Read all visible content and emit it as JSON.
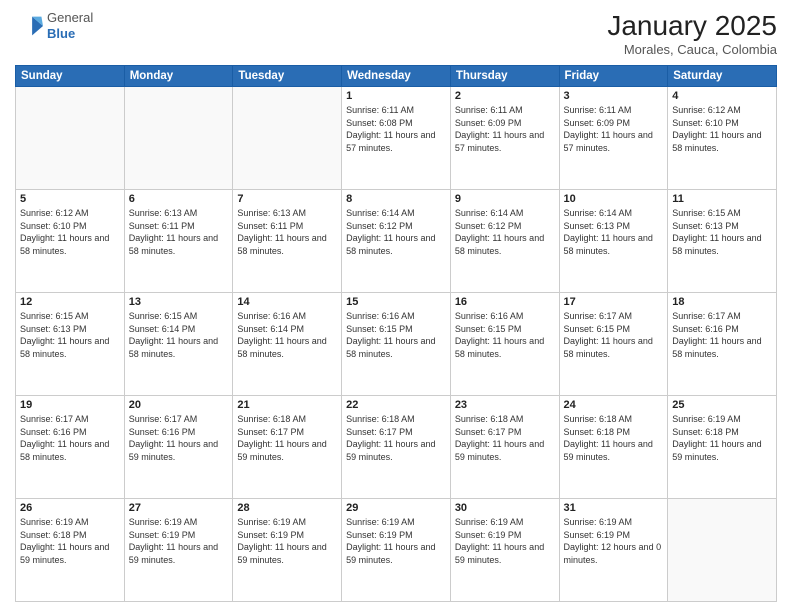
{
  "logo": {
    "general": "General",
    "blue": "Blue"
  },
  "header": {
    "title": "January 2025",
    "subtitle": "Morales, Cauca, Colombia"
  },
  "weekdays": [
    "Sunday",
    "Monday",
    "Tuesday",
    "Wednesday",
    "Thursday",
    "Friday",
    "Saturday"
  ],
  "weeks": [
    [
      {
        "day": "",
        "info": ""
      },
      {
        "day": "",
        "info": ""
      },
      {
        "day": "",
        "info": ""
      },
      {
        "day": "1",
        "info": "Sunrise: 6:11 AM\nSunset: 6:08 PM\nDaylight: 11 hours and 57 minutes."
      },
      {
        "day": "2",
        "info": "Sunrise: 6:11 AM\nSunset: 6:09 PM\nDaylight: 11 hours and 57 minutes."
      },
      {
        "day": "3",
        "info": "Sunrise: 6:11 AM\nSunset: 6:09 PM\nDaylight: 11 hours and 57 minutes."
      },
      {
        "day": "4",
        "info": "Sunrise: 6:12 AM\nSunset: 6:10 PM\nDaylight: 11 hours and 58 minutes."
      }
    ],
    [
      {
        "day": "5",
        "info": "Sunrise: 6:12 AM\nSunset: 6:10 PM\nDaylight: 11 hours and 58 minutes."
      },
      {
        "day": "6",
        "info": "Sunrise: 6:13 AM\nSunset: 6:11 PM\nDaylight: 11 hours and 58 minutes."
      },
      {
        "day": "7",
        "info": "Sunrise: 6:13 AM\nSunset: 6:11 PM\nDaylight: 11 hours and 58 minutes."
      },
      {
        "day": "8",
        "info": "Sunrise: 6:14 AM\nSunset: 6:12 PM\nDaylight: 11 hours and 58 minutes."
      },
      {
        "day": "9",
        "info": "Sunrise: 6:14 AM\nSunset: 6:12 PM\nDaylight: 11 hours and 58 minutes."
      },
      {
        "day": "10",
        "info": "Sunrise: 6:14 AM\nSunset: 6:13 PM\nDaylight: 11 hours and 58 minutes."
      },
      {
        "day": "11",
        "info": "Sunrise: 6:15 AM\nSunset: 6:13 PM\nDaylight: 11 hours and 58 minutes."
      }
    ],
    [
      {
        "day": "12",
        "info": "Sunrise: 6:15 AM\nSunset: 6:13 PM\nDaylight: 11 hours and 58 minutes."
      },
      {
        "day": "13",
        "info": "Sunrise: 6:15 AM\nSunset: 6:14 PM\nDaylight: 11 hours and 58 minutes."
      },
      {
        "day": "14",
        "info": "Sunrise: 6:16 AM\nSunset: 6:14 PM\nDaylight: 11 hours and 58 minutes."
      },
      {
        "day": "15",
        "info": "Sunrise: 6:16 AM\nSunset: 6:15 PM\nDaylight: 11 hours and 58 minutes."
      },
      {
        "day": "16",
        "info": "Sunrise: 6:16 AM\nSunset: 6:15 PM\nDaylight: 11 hours and 58 minutes."
      },
      {
        "day": "17",
        "info": "Sunrise: 6:17 AM\nSunset: 6:15 PM\nDaylight: 11 hours and 58 minutes."
      },
      {
        "day": "18",
        "info": "Sunrise: 6:17 AM\nSunset: 6:16 PM\nDaylight: 11 hours and 58 minutes."
      }
    ],
    [
      {
        "day": "19",
        "info": "Sunrise: 6:17 AM\nSunset: 6:16 PM\nDaylight: 11 hours and 58 minutes."
      },
      {
        "day": "20",
        "info": "Sunrise: 6:17 AM\nSunset: 6:16 PM\nDaylight: 11 hours and 59 minutes."
      },
      {
        "day": "21",
        "info": "Sunrise: 6:18 AM\nSunset: 6:17 PM\nDaylight: 11 hours and 59 minutes."
      },
      {
        "day": "22",
        "info": "Sunrise: 6:18 AM\nSunset: 6:17 PM\nDaylight: 11 hours and 59 minutes."
      },
      {
        "day": "23",
        "info": "Sunrise: 6:18 AM\nSunset: 6:17 PM\nDaylight: 11 hours and 59 minutes."
      },
      {
        "day": "24",
        "info": "Sunrise: 6:18 AM\nSunset: 6:18 PM\nDaylight: 11 hours and 59 minutes."
      },
      {
        "day": "25",
        "info": "Sunrise: 6:19 AM\nSunset: 6:18 PM\nDaylight: 11 hours and 59 minutes."
      }
    ],
    [
      {
        "day": "26",
        "info": "Sunrise: 6:19 AM\nSunset: 6:18 PM\nDaylight: 11 hours and 59 minutes."
      },
      {
        "day": "27",
        "info": "Sunrise: 6:19 AM\nSunset: 6:19 PM\nDaylight: 11 hours and 59 minutes."
      },
      {
        "day": "28",
        "info": "Sunrise: 6:19 AM\nSunset: 6:19 PM\nDaylight: 11 hours and 59 minutes."
      },
      {
        "day": "29",
        "info": "Sunrise: 6:19 AM\nSunset: 6:19 PM\nDaylight: 11 hours and 59 minutes."
      },
      {
        "day": "30",
        "info": "Sunrise: 6:19 AM\nSunset: 6:19 PM\nDaylight: 11 hours and 59 minutes."
      },
      {
        "day": "31",
        "info": "Sunrise: 6:19 AM\nSunset: 6:19 PM\nDaylight: 12 hours and 0 minutes."
      },
      {
        "day": "",
        "info": ""
      }
    ]
  ]
}
